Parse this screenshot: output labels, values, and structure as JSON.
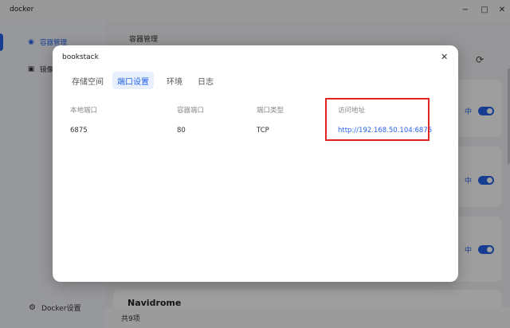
{
  "window": {
    "title": "docker",
    "min_label": "−",
    "max_label": "□",
    "close_label": "✕"
  },
  "sidebar": {
    "items": [
      {
        "label": "容器管理",
        "icon": "container-icon",
        "glyph": "◉",
        "active": true
      },
      {
        "label": "镜像",
        "icon": "image-icon",
        "glyph": "▣",
        "active": false
      }
    ],
    "settings": {
      "label": "Docker设置",
      "icon": "settings-icon",
      "glyph": "⚙"
    }
  },
  "main": {
    "title": "容器管理",
    "refresh_glyph": "⟳",
    "cards": [
      {
        "status": "中"
      },
      {
        "status": "中"
      },
      {
        "status": "中"
      },
      {
        "name": "Navidrome"
      }
    ],
    "footer_count": "共9项"
  },
  "modal": {
    "title": "bookstack",
    "close_glyph": "✕",
    "tabs": [
      {
        "label": "存储空间",
        "active": false
      },
      {
        "label": "端口设置",
        "active": true
      },
      {
        "label": "环境",
        "active": false
      },
      {
        "label": "日志",
        "active": false
      }
    ],
    "table": {
      "headers": [
        "本地端口",
        "容器端口",
        "端口类型",
        "访问地址"
      ],
      "rows": [
        {
          "local_port": "6875",
          "container_port": "80",
          "port_type": "TCP",
          "access_url": "http://192.168.50.104:6875"
        }
      ]
    }
  },
  "colors": {
    "accent": "#2563eb",
    "highlight": "#e02424"
  }
}
